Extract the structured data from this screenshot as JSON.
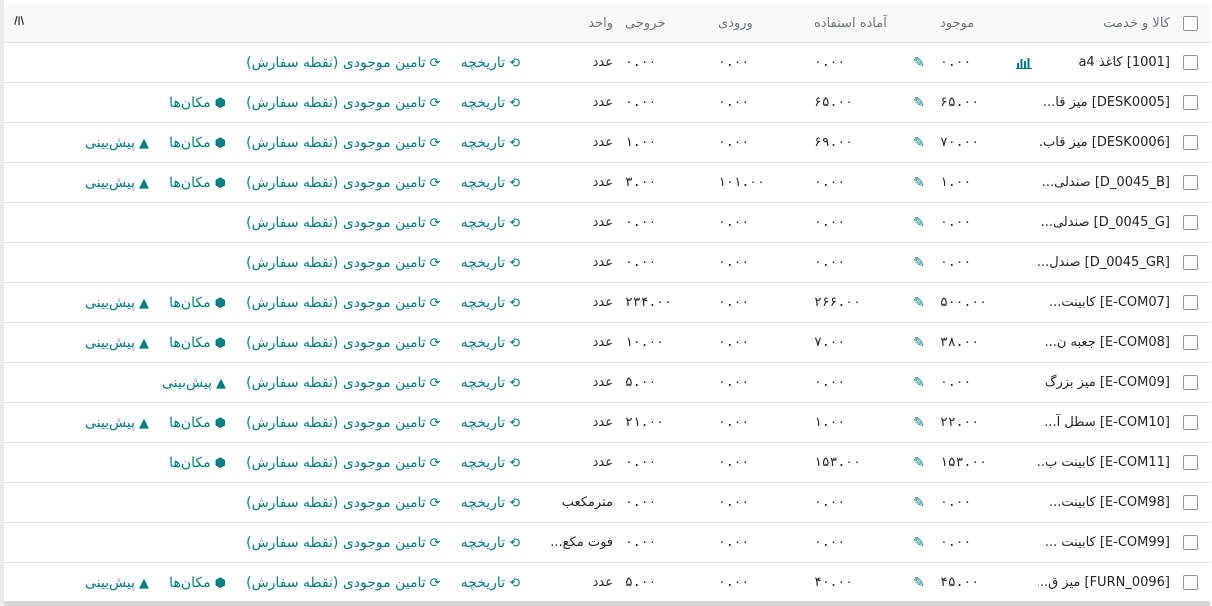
{
  "header": {
    "product": "کالا و خدمت",
    "on_hand": "موجود",
    "available": "آماده استفاده",
    "incoming": "ورودی",
    "outgoing": "خروجی",
    "uom": "واحد",
    "options_icon": "sliders-icon"
  },
  "actions": {
    "history": "تاریخچه",
    "replenish": "تامین موجودی (نقطه سفارش)",
    "locations": "مکان‌ها",
    "forecast": "پیش‌بینی"
  },
  "colors": {
    "accent": "#017e84"
  },
  "rows": [
    {
      "product": "[1001] کاغذ a4",
      "graph": true,
      "on_hand": "۰.۰۰",
      "available": "۰.۰۰",
      "incoming": "۰.۰۰",
      "outgoing": "۰.۰۰",
      "uom": "عدد",
      "locations": false,
      "forecast": false
    },
    {
      "product": "[DESK0005] میز قا...",
      "graph": false,
      "on_hand": "۶۵.۰۰",
      "available": "۶۵.۰۰",
      "incoming": "۰.۰۰",
      "outgoing": "۰.۰۰",
      "uom": "عدد",
      "locations": true,
      "forecast": false
    },
    {
      "product": "[DESK0006] میز قاب...",
      "graph": false,
      "on_hand": "۷۰.۰۰",
      "available": "۶۹.۰۰",
      "incoming": "۰.۰۰",
      "outgoing": "۱.۰۰",
      "uom": "عدد",
      "locations": true,
      "forecast": true
    },
    {
      "product": "[D_0045_B] صندلی...",
      "graph": false,
      "on_hand": "۱.۰۰",
      "available": "۰.۰۰",
      "incoming": "۱۰۱.۰۰",
      "outgoing": "۳.۰۰",
      "uom": "عدد",
      "locations": true,
      "forecast": true
    },
    {
      "product": "[D_0045_G] صندلی...",
      "graph": false,
      "on_hand": "۰.۰۰",
      "available": "۰.۰۰",
      "incoming": "۰.۰۰",
      "outgoing": "۰.۰۰",
      "uom": "عدد",
      "locations": false,
      "forecast": false
    },
    {
      "product": "[D_0045_GR] صندل...",
      "graph": false,
      "on_hand": "۰.۰۰",
      "available": "۰.۰۰",
      "incoming": "۰.۰۰",
      "outgoing": "۰.۰۰",
      "uom": "عدد",
      "locations": false,
      "forecast": false
    },
    {
      "product": "[E-COM07] کابینت...",
      "graph": false,
      "on_hand": "۵۰۰.۰۰",
      "available": "۲۶۶.۰۰",
      "incoming": "۰.۰۰",
      "outgoing": "۲۳۴.۰۰",
      "uom": "عدد",
      "locations": true,
      "forecast": true
    },
    {
      "product": "[E-COM08] جعبه ن...",
      "graph": false,
      "on_hand": "۳۸.۰۰",
      "available": "۷.۰۰",
      "incoming": "۰.۰۰",
      "outgoing": "۱۰.۰۰",
      "uom": "عدد",
      "locations": true,
      "forecast": true
    },
    {
      "product": "[E-COM09] میز بزرگ",
      "graph": false,
      "on_hand": "۰.۰۰",
      "available": "۰.۰۰",
      "incoming": "۰.۰۰",
      "outgoing": "۵.۰۰",
      "uom": "عدد",
      "locations": false,
      "forecast": true
    },
    {
      "product": "[E-COM10] سطل آ...",
      "graph": false,
      "on_hand": "۲۲.۰۰",
      "available": "۱.۰۰",
      "incoming": "۰.۰۰",
      "outgoing": "۲۱.۰۰",
      "uom": "عدد",
      "locations": true,
      "forecast": true
    },
    {
      "product": "[E-COM11] کابینت ب...",
      "graph": false,
      "on_hand": "۱۵۳.۰۰",
      "available": "۱۵۳.۰۰",
      "incoming": "۰.۰۰",
      "outgoing": "۰.۰۰",
      "uom": "عدد",
      "locations": true,
      "forecast": false
    },
    {
      "product": "[E-COM98] کابینت...",
      "graph": false,
      "on_hand": "۰.۰۰",
      "available": "۰.۰۰",
      "incoming": "۰.۰۰",
      "outgoing": "۰.۰۰",
      "uom": "مترمکعب",
      "locations": false,
      "forecast": false
    },
    {
      "product": "[E-COM99] کابینت ...",
      "graph": false,
      "on_hand": "۰.۰۰",
      "available": "۰.۰۰",
      "incoming": "۰.۰۰",
      "outgoing": "۰.۰۰",
      "uom": "فوت مکع...",
      "locations": false,
      "forecast": false
    },
    {
      "product": "[FURN_0096] میز ق...",
      "graph": false,
      "on_hand": "۴۵.۰۰",
      "available": "۴۰.۰۰",
      "incoming": "۰.۰۰",
      "outgoing": "۵.۰۰",
      "uom": "عدد",
      "locations": true,
      "forecast": true
    }
  ]
}
